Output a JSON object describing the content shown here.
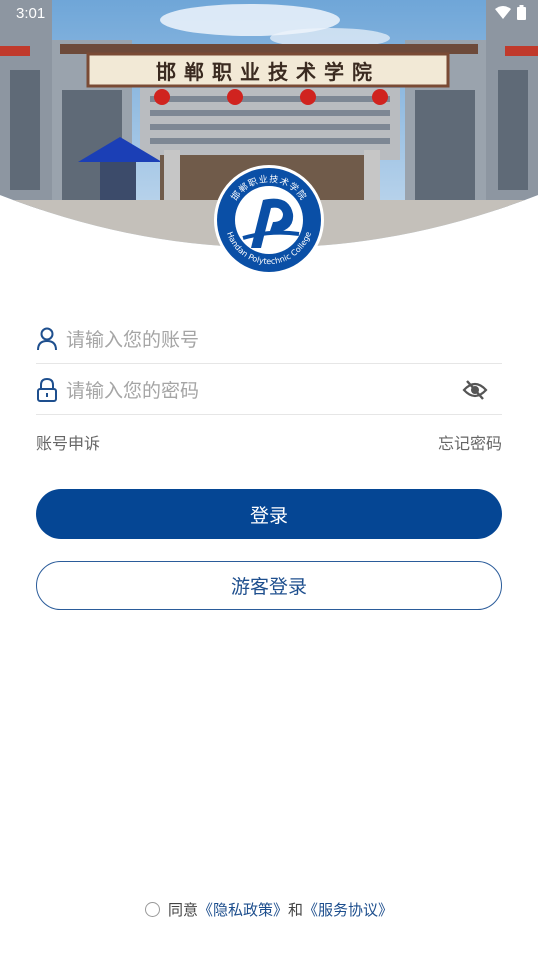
{
  "status_bar": {
    "time": "3:01",
    "icons": [
      "wifi-icon",
      "battery-icon"
    ]
  },
  "header": {
    "gate_sign": "邯郸职业技术学院",
    "logo": {
      "cn_text": "邯郸职业技术学院",
      "en_text": "Handan Polytechnic College"
    }
  },
  "form": {
    "account_placeholder": "请输入您的账号",
    "password_placeholder": "请输入您的密码",
    "account_appeal": "账号申诉",
    "forgot_password": "忘记密码"
  },
  "buttons": {
    "login": "登录",
    "guest_login": "游客登录"
  },
  "agreement": {
    "prefix": "同意",
    "privacy_policy": "《隐私政策》",
    "and": "和",
    "service_agreement": "《服务协议》"
  },
  "colors": {
    "primary": "#054694",
    "link": "#1e4f8e",
    "placeholder": "#a5a5a5"
  }
}
